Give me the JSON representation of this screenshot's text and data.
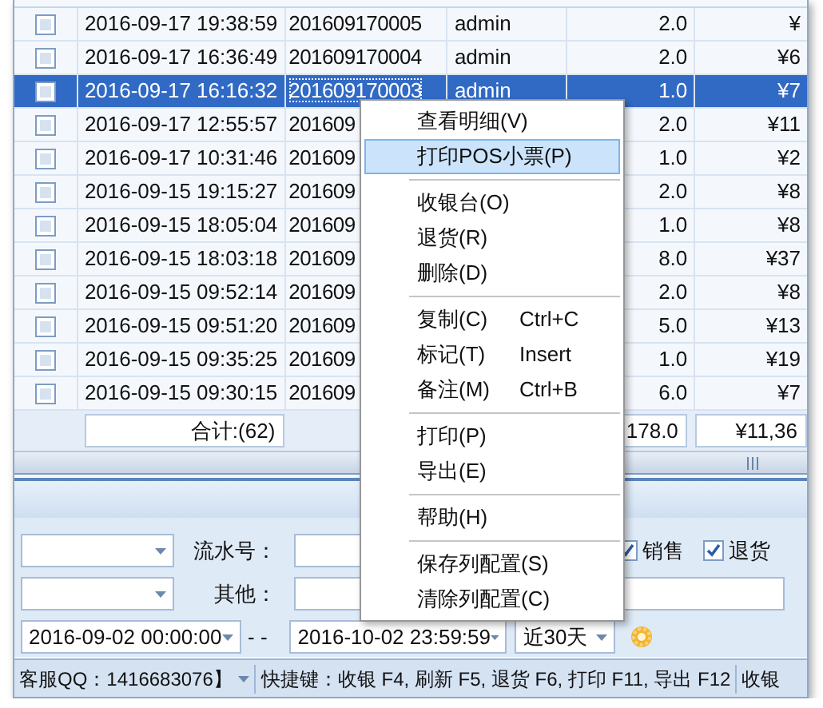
{
  "grid": {
    "rows": [
      {
        "checked": false,
        "selected": false,
        "time": "2016-09-17 19:38:59",
        "number": "201609170005",
        "user": "admin",
        "qty": "2.0",
        "amount": "¥"
      },
      {
        "checked": false,
        "selected": false,
        "time": "2016-09-17 16:36:49",
        "number": "201609170004",
        "user": "admin",
        "qty": "2.0",
        "amount": "¥6"
      },
      {
        "checked": false,
        "selected": true,
        "time": "2016-09-17 16:16:32",
        "number": "201609170003",
        "user": "admin",
        "qty": "1.0",
        "amount": "¥7"
      },
      {
        "checked": false,
        "selected": false,
        "time": "2016-09-17 12:55:57",
        "number": "201609",
        "qty": "2.0",
        "amount": "¥11"
      },
      {
        "checked": false,
        "selected": false,
        "time": "2016-09-17 10:31:46",
        "number": "201609",
        "qty": "1.0",
        "amount": "¥2"
      },
      {
        "checked": false,
        "selected": false,
        "time": "2016-09-15 19:15:27",
        "number": "201609",
        "qty": "2.0",
        "amount": "¥8"
      },
      {
        "checked": false,
        "selected": false,
        "time": "2016-09-15 18:05:04",
        "number": "201609",
        "qty": "1.0",
        "amount": "¥8"
      },
      {
        "checked": false,
        "selected": false,
        "time": "2016-09-15 18:03:18",
        "number": "201609",
        "qty": "8.0",
        "amount": "¥37"
      },
      {
        "checked": false,
        "selected": false,
        "time": "2016-09-15 09:52:14",
        "number": "201609",
        "qty": "2.0",
        "amount": "¥8"
      },
      {
        "checked": false,
        "selected": false,
        "time": "2016-09-15 09:51:20",
        "number": "201609",
        "qty": "5.0",
        "amount": "¥13"
      },
      {
        "checked": false,
        "selected": false,
        "time": "2016-09-15 09:35:25",
        "number": "201609",
        "qty": "1.0",
        "amount": "¥19"
      },
      {
        "checked": false,
        "selected": false,
        "time": "2016-09-15 09:30:15",
        "number": "201609",
        "qty": "6.0",
        "amount": "¥7"
      }
    ],
    "summary": {
      "count": "合计:(62)",
      "qty": "178.0",
      "amount": "¥11,36"
    }
  },
  "filters": {
    "serial_label": "流水号：",
    "other_label": "其他：",
    "checkboxes": [
      {
        "label": "销售",
        "checked": true
      },
      {
        "label": "退货",
        "checked": true
      }
    ],
    "date_from": "2016-09-02 00:00:00",
    "range_separator": "- -",
    "date_to": "2016-10-02 23:59:59",
    "range": "近30天"
  },
  "status_bar": {
    "items": [
      "客服QQ：1416683076】",
      "快捷键：收银 F4, 刷新 F5, 退货 F6, 打印 F11, 导出 F12",
      "收银"
    ]
  },
  "context_menu": {
    "items": [
      {
        "kind": "item",
        "label": "查看明细(V)",
        "selected": false
      },
      {
        "kind": "item",
        "label": "打印POS小票(P)",
        "selected": true
      },
      {
        "kind": "separator"
      },
      {
        "kind": "item",
        "label": "收银台(O)",
        "selected": false
      },
      {
        "kind": "item",
        "label": "退货(R)",
        "selected": false
      },
      {
        "kind": "item",
        "label": "删除(D)",
        "selected": false
      },
      {
        "kind": "separator"
      },
      {
        "kind": "item",
        "label": "复制(C)",
        "shortcut": "Ctrl+C",
        "selected": false
      },
      {
        "kind": "item",
        "label": "标记(T)",
        "shortcut": "Insert",
        "selected": false
      },
      {
        "kind": "item",
        "label": "备注(M)",
        "shortcut": "Ctrl+B",
        "selected": false
      },
      {
        "kind": "separator"
      },
      {
        "kind": "item",
        "label": "打印(P)",
        "selected": false
      },
      {
        "kind": "item",
        "label": "导出(E)",
        "selected": false
      },
      {
        "kind": "separator"
      },
      {
        "kind": "item",
        "label": "帮助(H)",
        "selected": false
      },
      {
        "kind": "separator"
      },
      {
        "kind": "item",
        "label": "保存列配置(S)",
        "selected": false
      },
      {
        "kind": "item",
        "label": "清除列配置(C)",
        "selected": false
      }
    ]
  }
}
